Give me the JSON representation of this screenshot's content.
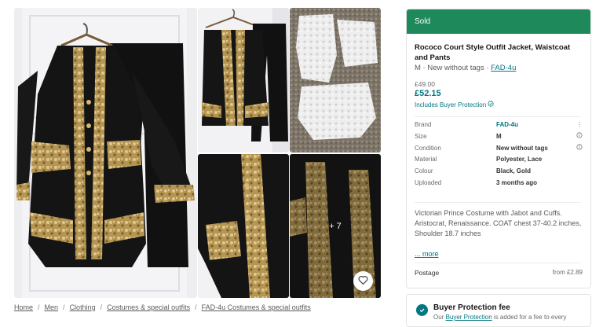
{
  "gallery": {
    "more_photos_label": "+ 7",
    "favourite_icon": "heart-icon"
  },
  "breadcrumb": [
    "Home",
    "Men",
    "Clothing",
    "Costumes & special outfits",
    "FAD-4u Costumes & special outfits"
  ],
  "listing": {
    "status": "Sold",
    "title": "Rococo Court Style Outfit Jacket, Waistcoat and Pants",
    "size_condition": "M · New without tags · ",
    "brand_link": "FAD-4u",
    "original_price": "£49.00",
    "price": "£52.15",
    "buyer_protection": "Includes Buyer Protection",
    "details": [
      {
        "key": "Brand",
        "value": "FAD-4u",
        "icon": "more-icon"
      },
      {
        "key": "Size",
        "value": "M",
        "icon": "info-icon"
      },
      {
        "key": "Condition",
        "value": "New without tags",
        "icon": "info-icon"
      },
      {
        "key": "Material",
        "value": "Polyester, Lace",
        "icon": ""
      },
      {
        "key": "Colour",
        "value": "Black, Gold",
        "icon": ""
      },
      {
        "key": "Uploaded",
        "value": "3 months ago",
        "icon": ""
      }
    ],
    "description": "Victorian Prince Costume with Jabot and Cuffs. Aristocrat, Renaissance. COAT chest 37-40.2 inches, Shoulder 18.7 inches",
    "more_label": "... more",
    "postage_label": "Postage",
    "postage_value": "from £2.89"
  },
  "buyer_protection_card": {
    "title": "Buyer Protection fee",
    "text_prefix": "Our ",
    "text_link": "Buyer Protection",
    "text_suffix": " is added for a fee to every"
  },
  "colors": {
    "accent": "#007782",
    "sold_bar": "#1e8a5c",
    "coat_black": "#141414",
    "lace_gold": "#c8a866"
  }
}
